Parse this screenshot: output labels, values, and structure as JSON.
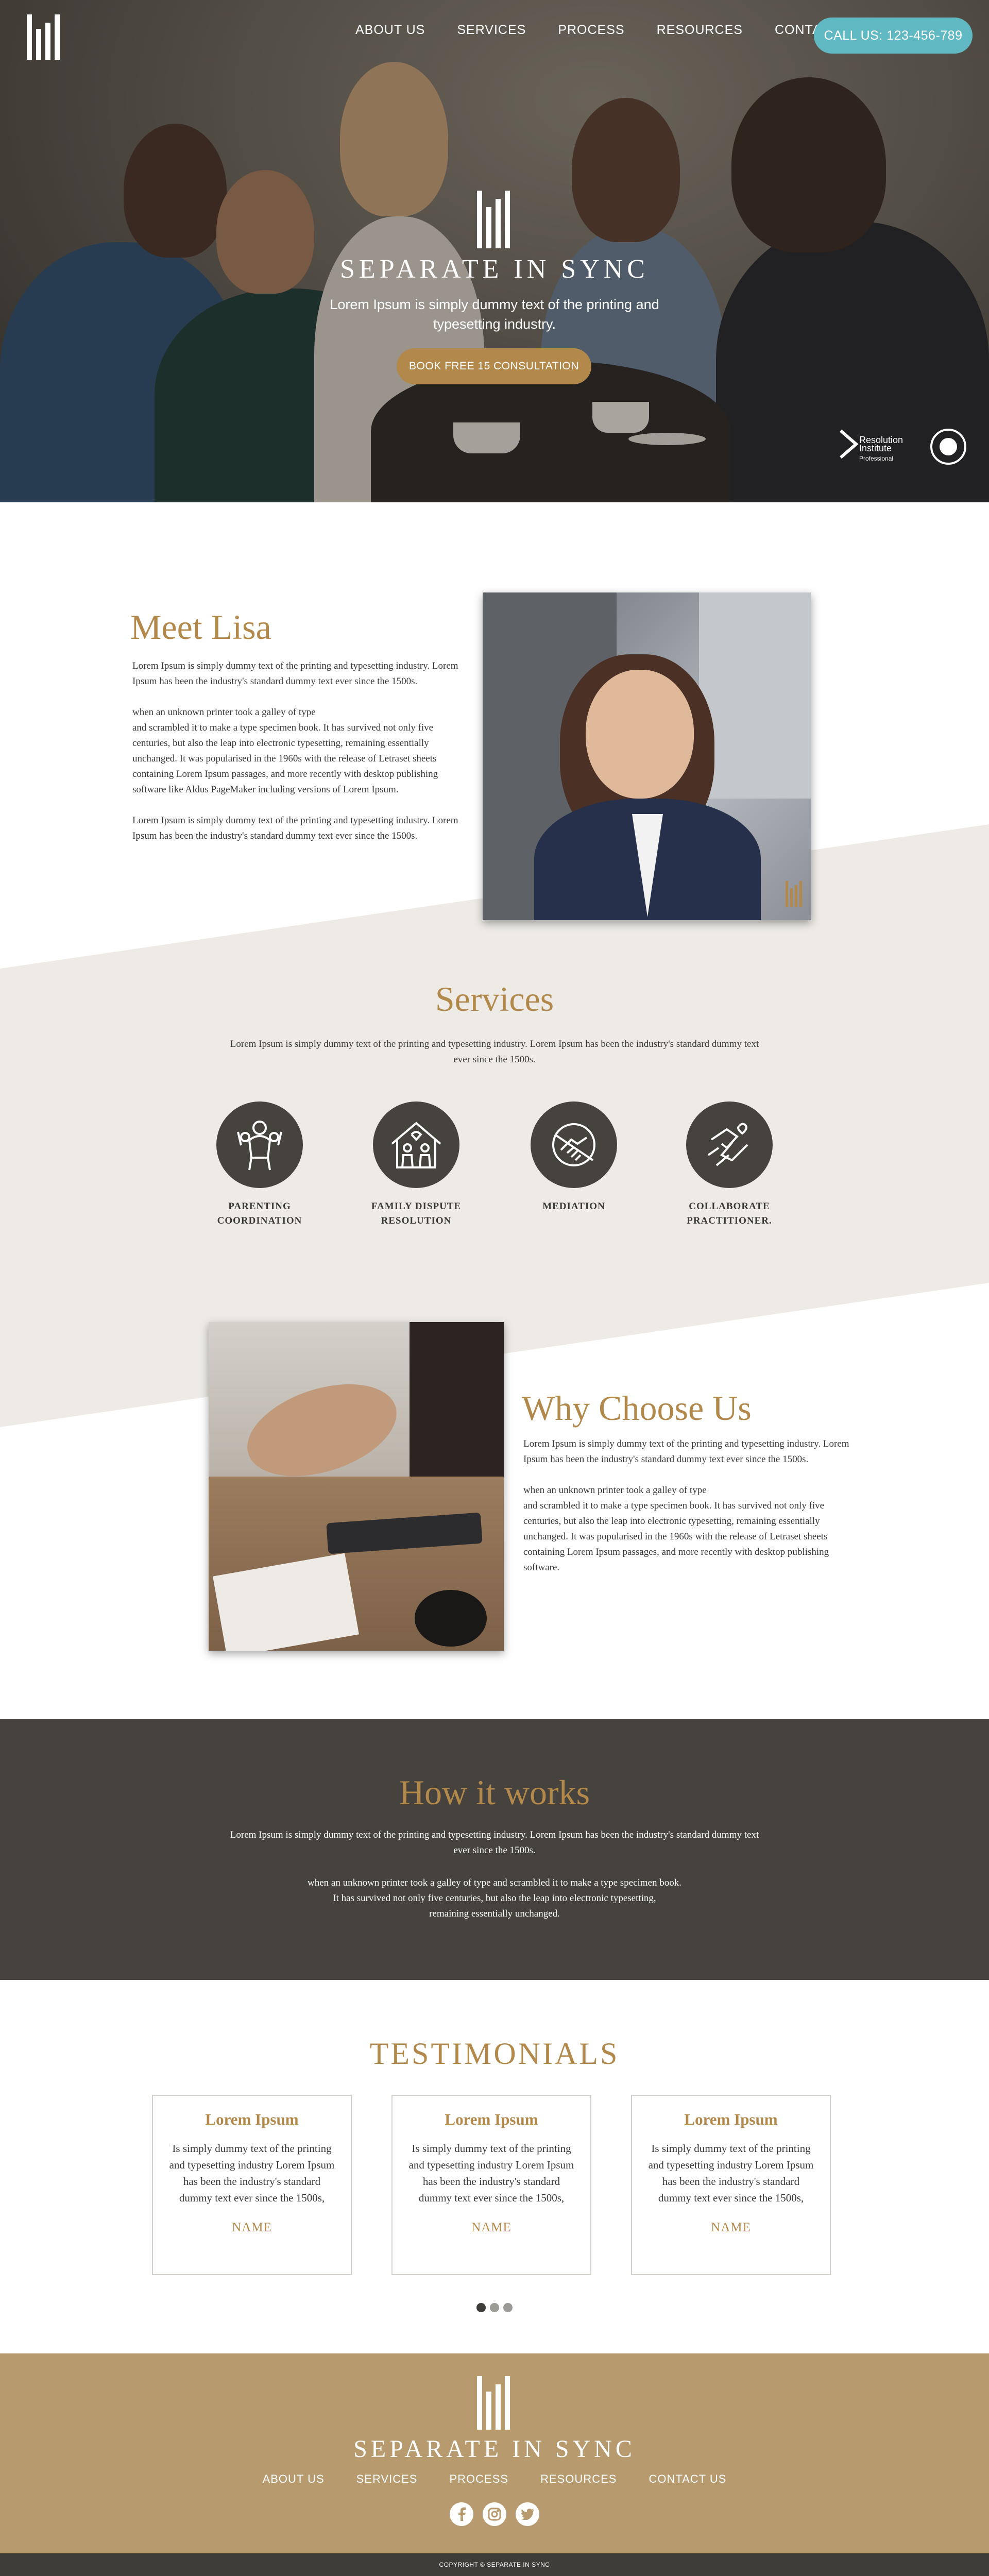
{
  "brand": {
    "name": "SEPARATE IN SYNC",
    "accent": "#b2894b",
    "teal": "#5fb8c2",
    "dark": "#46433f",
    "footer_bg": "#b79b6e"
  },
  "nav": {
    "items": [
      "ABOUT US",
      "SERVICES",
      "PROCESS",
      "RESOURCES",
      "CONTACT US"
    ],
    "call_button": "CALL US: 123-456-789"
  },
  "hero": {
    "title": "SEPARATE IN SYNC",
    "subtitle": "Lorem Ipsum is simply dummy text of the printing and typesetting industry.",
    "cta": "BOOK FREE 15 CONSULTATION",
    "badge1_line1": "Resolution",
    "badge1_line2": "Institute",
    "badge1_line3": "Professional"
  },
  "meet": {
    "title": "Meet Lisa",
    "p1": "Lorem Ipsum is simply dummy text of the printing and typesetting industry. Lorem Ipsum has been the industry's standard dummy text ever since the 1500s.",
    "p2_line1": "when an unknown printer took a galley of type",
    "p2_rest": "and scrambled it to make a type specimen book. It has survived not only five centuries, but also the leap into electronic typesetting, remaining essentially unchanged. It was popularised in the 1960s with the release of Letraset sheets containing Lorem Ipsum passages, and more recently with desktop publishing software like Aldus PageMaker including versions of Lorem Ipsum.",
    "p3": "Lorem Ipsum is simply dummy text of the printing and typesetting industry. Lorem Ipsum has been the industry's standard dummy text ever since the 1500s."
  },
  "services": {
    "title": "Services",
    "intro": "Lorem Ipsum is simply dummy text of the printing and typesetting industry. Lorem Ipsum has been the industry's standard dummy text ever since the 1500s.",
    "items": [
      {
        "line1": "PARENTING",
        "line2": "COORDINATION",
        "icon": "family-icon"
      },
      {
        "line1": "FAMILY DISPUTE",
        "line2": "RESOLUTION",
        "icon": "house-family-icon"
      },
      {
        "line1": "MEDIATION",
        "line2": "",
        "icon": "handshake-icon"
      },
      {
        "line1": "COLLABORATE",
        "line2": "PRACTITIONER.",
        "icon": "heart-hands-icon"
      }
    ]
  },
  "why": {
    "title": "Why Choose Us",
    "p1": "Lorem Ipsum is simply dummy text of the printing and typesetting industry. Lorem Ipsum has been the industry's standard dummy text ever since the 1500s.",
    "p2_line1": "when an unknown printer took a galley of type",
    "p2_rest": "and scrambled it to make a type specimen book. It has survived not only five centuries, but also the leap into electronic typesetting, remaining essentially unchanged. It was popularised in the 1960s with the release of Letraset sheets containing Lorem Ipsum passages, and more recently with desktop publishing software."
  },
  "how": {
    "title": "How it works",
    "p1": "Lorem Ipsum is simply dummy text of the printing and typesetting industry. Lorem Ipsum has been the industry's standard dummy text ever since the 1500s.",
    "p2_line1": "when an unknown printer took a galley of type and scrambled it to make a type specimen book.",
    "p2_line2": "It has survived not only five centuries, but also the leap into electronic typesetting,",
    "p2_line3": "remaining essentially unchanged."
  },
  "testimonials": {
    "title": "TESTIMONIALS",
    "cards": [
      {
        "title": "Lorem Ipsum",
        "body": "Is simply dummy text of the printing and typesetting industry Lorem Ipsum has been the industry's standard dummy text ever since the 1500s,",
        "name": "NAME"
      },
      {
        "title": "Lorem Ipsum",
        "body": "Is simply dummy text of the printing and typesetting industry Lorem Ipsum has been the industry's standard dummy text ever since the 1500s,",
        "name": "NAME"
      },
      {
        "title": "Lorem Ipsum",
        "body": "Is simply dummy text of the printing and typesetting industry Lorem Ipsum has been the industry's standard dummy text ever since the 1500s,",
        "name": "NAME"
      }
    ]
  },
  "footer": {
    "title": "SEPARATE IN SYNC",
    "nav": [
      "ABOUT US",
      "SERVICES",
      "PROCESS",
      "RESOURCES",
      "CONTACT US"
    ],
    "social": [
      "facebook-icon",
      "instagram-icon",
      "twitter-icon"
    ],
    "copyright": "COPYRIGHT © SEPARATE IN SYNC"
  }
}
